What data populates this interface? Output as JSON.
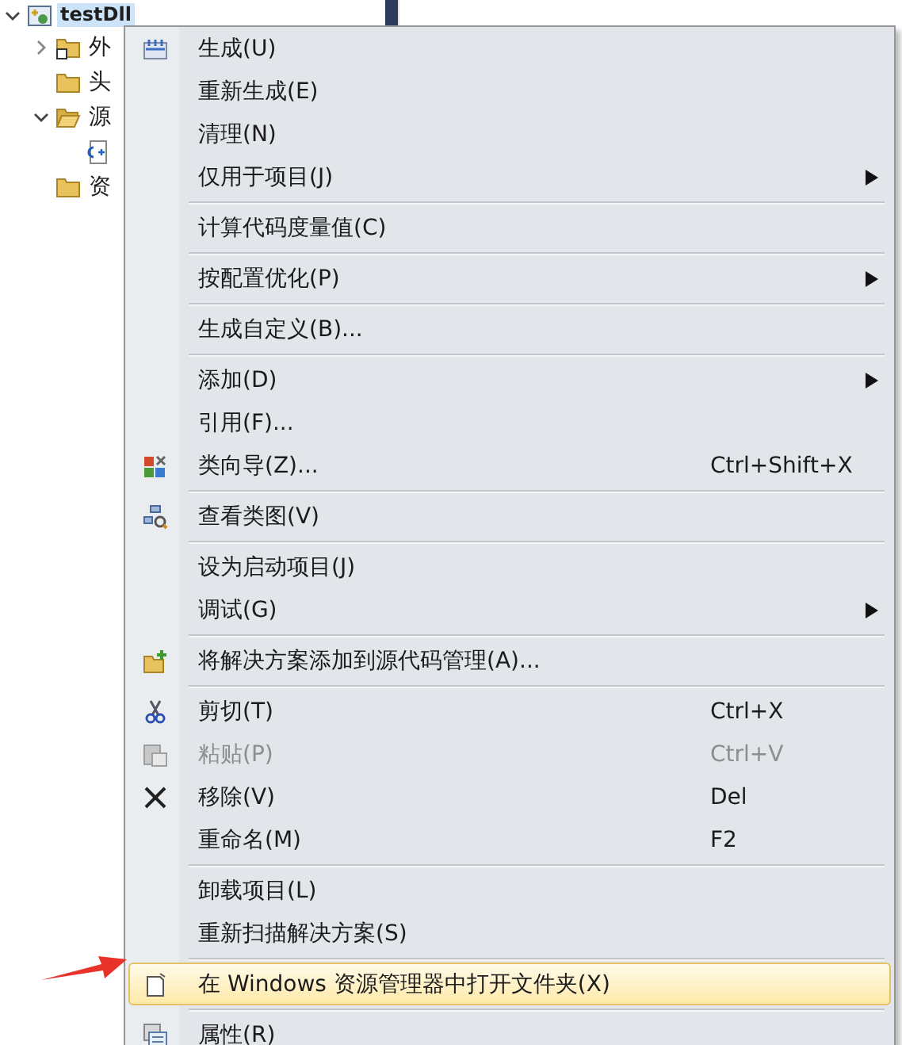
{
  "tree": {
    "project": {
      "label": "testDll",
      "selected": true,
      "expanded": true
    },
    "children": [
      {
        "label": "外",
        "kind": "shortcut-folder",
        "expanded": false
      },
      {
        "label": "头",
        "kind": "folder"
      },
      {
        "label": "源",
        "kind": "open-folder",
        "expanded": true,
        "children": [
          {
            "kind": "cpp-file"
          }
        ]
      },
      {
        "label": "资",
        "kind": "folder"
      }
    ]
  },
  "context_menu": {
    "items": [
      {
        "kind": "item",
        "label": "生成(U)"
      },
      {
        "kind": "item",
        "label": "重新生成(E)"
      },
      {
        "kind": "item",
        "label": "清理(N)"
      },
      {
        "kind": "item",
        "label": "仅用于项目(J)",
        "submenu": true
      },
      {
        "kind": "separator"
      },
      {
        "kind": "item",
        "label": "计算代码度量值(C)"
      },
      {
        "kind": "separator"
      },
      {
        "kind": "item",
        "label": "按配置优化(P)",
        "submenu": true
      },
      {
        "kind": "separator"
      },
      {
        "kind": "item",
        "label": "生成自定义(B)..."
      },
      {
        "kind": "separator"
      },
      {
        "kind": "item",
        "label": "添加(D)",
        "submenu": true
      },
      {
        "kind": "item",
        "label": "引用(F)..."
      },
      {
        "kind": "item",
        "label": "类向导(Z)...",
        "shortcut": "Ctrl+Shift+X"
      },
      {
        "kind": "separator"
      },
      {
        "kind": "item",
        "label": "查看类图(V)"
      },
      {
        "kind": "separator"
      },
      {
        "kind": "item",
        "label": "设为启动项目(J)"
      },
      {
        "kind": "item",
        "label": "调试(G)",
        "submenu": true
      },
      {
        "kind": "separator"
      },
      {
        "kind": "item",
        "label": "将解决方案添加到源代码管理(A)..."
      },
      {
        "kind": "separator"
      },
      {
        "kind": "item",
        "label": "剪切(T)",
        "shortcut": "Ctrl+X"
      },
      {
        "kind": "item",
        "label": "粘贴(P)",
        "shortcut": "Ctrl+V",
        "disabled": true
      },
      {
        "kind": "item",
        "label": "移除(V)",
        "shortcut": "Del"
      },
      {
        "kind": "item",
        "label": "重命名(M)",
        "shortcut": "F2"
      },
      {
        "kind": "separator"
      },
      {
        "kind": "item",
        "label": "卸载项目(L)"
      },
      {
        "kind": "item",
        "label": "重新扫描解决方案(S)"
      },
      {
        "kind": "separator"
      },
      {
        "kind": "item",
        "label": "在 Windows 资源管理器中打开文件夹(X)",
        "selected": true
      },
      {
        "kind": "separator"
      },
      {
        "kind": "item",
        "label": "属性(R)"
      }
    ]
  }
}
